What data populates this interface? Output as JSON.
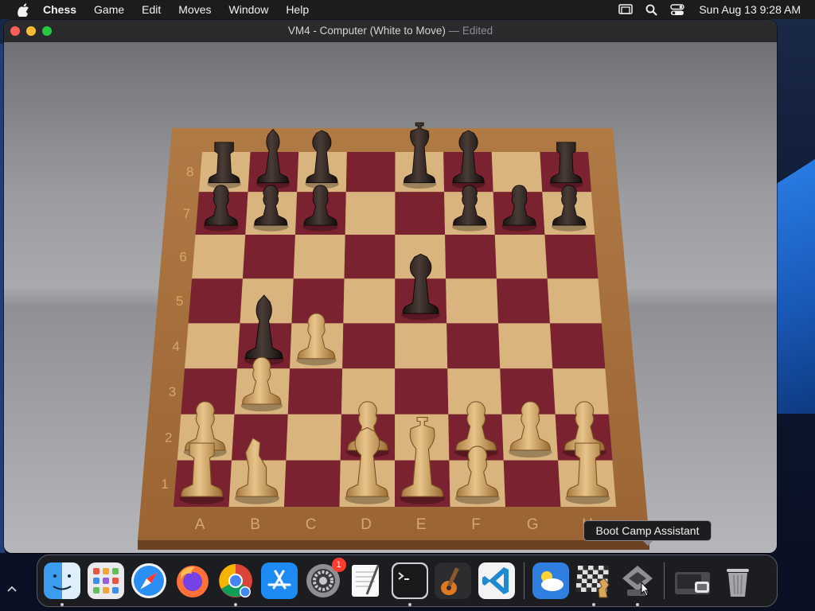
{
  "menubar": {
    "app_name": "Chess",
    "items": [
      "Game",
      "Edit",
      "Moves",
      "Window",
      "Help"
    ],
    "clock": "Sun Aug 13  9:28 AM"
  },
  "window": {
    "title": "VM4 - Computer  (White to Move)",
    "separator": "—",
    "status": "Edited"
  },
  "board": {
    "files": [
      "A",
      "B",
      "C",
      "D",
      "E",
      "F",
      "G",
      "H"
    ],
    "ranks": [
      "8",
      "7",
      "6",
      "5",
      "4",
      "3",
      "2",
      "1"
    ],
    "pieces": [
      {
        "square": "a8",
        "type": "rook",
        "color": "black"
      },
      {
        "square": "b8",
        "type": "bishop",
        "color": "black"
      },
      {
        "square": "c8",
        "type": "queen",
        "color": "black"
      },
      {
        "square": "e8",
        "type": "king",
        "color": "black"
      },
      {
        "square": "f8",
        "type": "queen",
        "color": "black"
      },
      {
        "square": "h8",
        "type": "rook",
        "color": "black"
      },
      {
        "square": "a7",
        "type": "pawn",
        "color": "black"
      },
      {
        "square": "b7",
        "type": "pawn",
        "color": "black"
      },
      {
        "square": "c7",
        "type": "pawn",
        "color": "black"
      },
      {
        "square": "f7",
        "type": "pawn",
        "color": "black"
      },
      {
        "square": "g7",
        "type": "pawn",
        "color": "black"
      },
      {
        "square": "h7",
        "type": "pawn",
        "color": "black"
      },
      {
        "square": "e5",
        "type": "queen",
        "color": "black"
      },
      {
        "square": "b4",
        "type": "bishop",
        "color": "black"
      },
      {
        "square": "c4",
        "type": "pawn",
        "color": "white"
      },
      {
        "square": "b3",
        "type": "pawn",
        "color": "white"
      },
      {
        "square": "a2",
        "type": "pawn",
        "color": "white"
      },
      {
        "square": "d2",
        "type": "pawn",
        "color": "white"
      },
      {
        "square": "f2",
        "type": "pawn",
        "color": "white"
      },
      {
        "square": "g2",
        "type": "pawn",
        "color": "white"
      },
      {
        "square": "h2",
        "type": "pawn",
        "color": "white"
      },
      {
        "square": "a1",
        "type": "rook",
        "color": "white"
      },
      {
        "square": "b1",
        "type": "knight",
        "color": "white"
      },
      {
        "square": "d1",
        "type": "queen",
        "color": "white"
      },
      {
        "square": "e1",
        "type": "king",
        "color": "white"
      },
      {
        "square": "f1",
        "type": "pawn",
        "color": "white"
      },
      {
        "square": "h1",
        "type": "rook",
        "color": "white"
      }
    ]
  },
  "tooltip": "Boot Camp Assistant",
  "dock": {
    "apps": [
      {
        "name": "Finder",
        "icon": "finder-icon",
        "running": true
      },
      {
        "name": "Launchpad",
        "icon": "launchpad-icon",
        "running": false
      },
      {
        "name": "Safari",
        "icon": "safari-icon",
        "running": false
      },
      {
        "name": "Firefox",
        "icon": "firefox-icon",
        "running": false
      },
      {
        "name": "Chrome",
        "icon": "chrome-icon",
        "running": true
      },
      {
        "name": "App Store",
        "icon": "app-store-icon",
        "running": false
      },
      {
        "name": "System Settings",
        "icon": "settings-icon",
        "running": false,
        "badge": "1"
      },
      {
        "name": "TextEdit",
        "icon": "textedit-icon",
        "running": false
      },
      {
        "name": "Terminal",
        "icon": "terminal-icon",
        "running": true
      },
      {
        "name": "GarageBand",
        "icon": "garageband-icon",
        "running": false
      },
      {
        "name": "Visual Studio Code",
        "icon": "vscode-icon",
        "running": false
      }
    ],
    "recent": [
      {
        "name": "Weather",
        "icon": "weather-icon",
        "running": false
      },
      {
        "name": "Chess",
        "icon": "chess-icon",
        "running": true
      },
      {
        "name": "Boot Camp Assistant",
        "icon": "bootcamp-icon",
        "running": true
      }
    ],
    "extras": [
      {
        "name": "Downloads",
        "icon": "downloads-folder-icon"
      },
      {
        "name": "Trash",
        "icon": "trash-icon"
      }
    ]
  }
}
